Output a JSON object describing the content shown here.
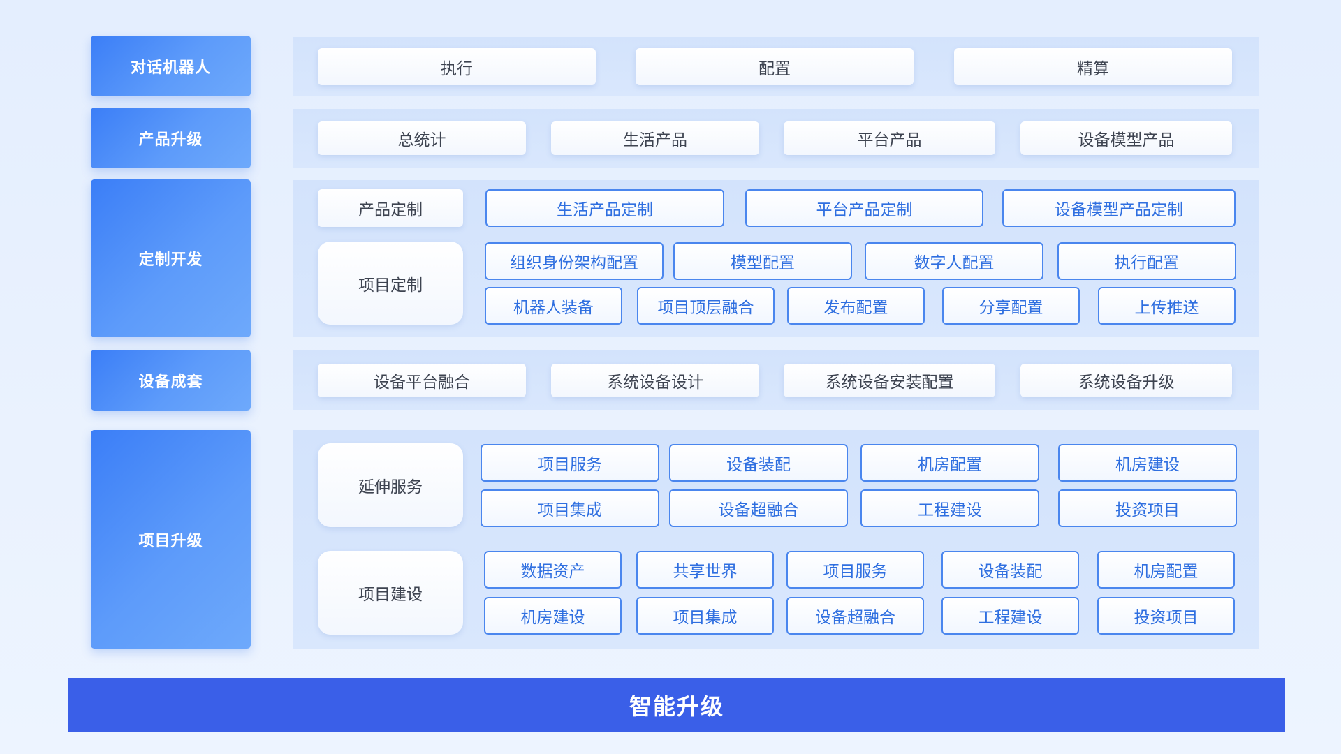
{
  "colors": {
    "category_block": "#4a8cf8",
    "panel_bg": "#d6e5fd",
    "tag_border": "#4a86ee",
    "tag_text": "#2f6fe0",
    "chip_text": "#3d4350",
    "bottom_bar": "#3a5fe8"
  },
  "rows": {
    "dialog_robot": {
      "label": "对话机器人",
      "items": [
        "执行",
        "配置",
        "精算"
      ]
    },
    "product_upgrade": {
      "label": "产品升级",
      "items": [
        "总统计",
        "生活产品",
        "平台产品",
        "设备模型产品"
      ]
    },
    "custom_dev": {
      "label": "定制开发",
      "product_custom": {
        "label": "产品定制",
        "items": [
          "生活产品定制",
          "平台产品定制",
          "设备模型产品定制"
        ]
      },
      "project_custom": {
        "label": "项目定制",
        "row1": [
          "组织身份架构配置",
          "模型配置",
          "数字人配置",
          "执行配置"
        ],
        "row2": [
          "机器人装备",
          "项目顶层融合",
          "发布配置",
          "分享配置",
          "上传推送"
        ]
      }
    },
    "device_set": {
      "label": "设备成套",
      "items": [
        "设备平台融合",
        "系统设备设计",
        "系统设备安装配置",
        "系统设备升级"
      ]
    },
    "project_upgrade": {
      "label": "项目升级",
      "extended_service": {
        "label": "延伸服务",
        "row1": [
          "项目服务",
          "设备装配",
          "机房配置",
          "机房建设"
        ],
        "row2": [
          "项目集成",
          "设备超融合",
          "工程建设",
          "投资项目"
        ]
      },
      "project_build": {
        "label": "项目建设",
        "row1": [
          "数据资产",
          "共享世界",
          "项目服务",
          "设备装配",
          "机房配置"
        ],
        "row2": [
          "机房建设",
          "项目集成",
          "设备超融合",
          "工程建设",
          "投资项目"
        ]
      }
    }
  },
  "bottom": {
    "label": "智能升级"
  }
}
